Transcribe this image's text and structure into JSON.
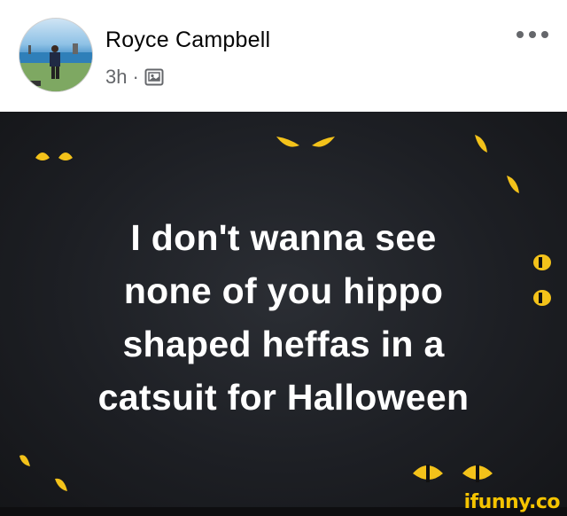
{
  "post": {
    "author_name": "Royce Campbell",
    "timestamp": "3h",
    "separator": "·",
    "audience_icon": "photo-album-icon",
    "more_icon": "more-options-icon"
  },
  "meme": {
    "lines": [
      "I don't wanna see",
      "none of you hippo",
      "shaped heffas in a",
      "catsuit for Halloween"
    ],
    "eye_color": "#f3c21a",
    "watermark": "ifunny.co"
  }
}
